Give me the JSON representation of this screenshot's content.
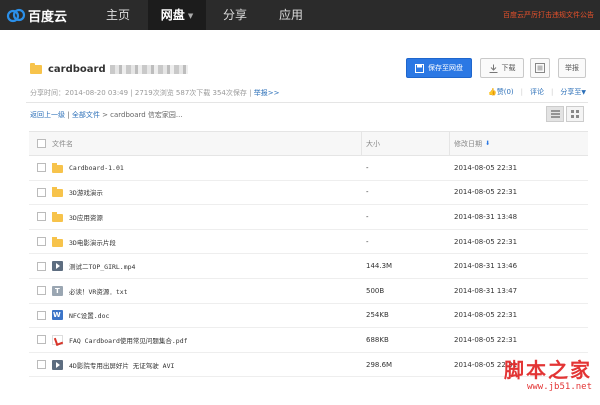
{
  "header": {
    "logo_text": "百度云",
    "nav": [
      {
        "label": "主页"
      },
      {
        "label": "网盘",
        "active": true
      },
      {
        "label": "分享"
      },
      {
        "label": "应用"
      }
    ],
    "notice": "百度云严厉打击违规文件公告"
  },
  "share": {
    "title": "cardboard",
    "buttons": {
      "save": "保存至网盘",
      "download": "下载",
      "report": "举报"
    },
    "meta": "分享时间：2014-08-20 03:49 | 2719次浏览 587次下载 354次保存 |",
    "report_link": "举报>>",
    "actions": {
      "like": "赞(0)",
      "comment": "评论",
      "share_to": "分享至"
    }
  },
  "breadcrumb": {
    "back": "返回上一级",
    "all": "全部文件",
    "path": "> cardboard 信宏家园..."
  },
  "table": {
    "headers": {
      "name": "文件名",
      "size": "大小",
      "date": "修改日期"
    },
    "rows": [
      {
        "icon": "folder",
        "name": "Cardboard-1.01",
        "size": "-",
        "date": "2014-08-05 22:31"
      },
      {
        "icon": "folder",
        "name": "3D游戏演示",
        "size": "-",
        "date": "2014-08-05 22:31"
      },
      {
        "icon": "folder",
        "name": "3D应用资源",
        "size": "-",
        "date": "2014-08-31 13:48"
      },
      {
        "icon": "folder",
        "name": "3D电影演示片段",
        "size": "-",
        "date": "2014-08-05 22:31"
      },
      {
        "icon": "video",
        "name": "测试二TOP_GIRL.mp4",
        "size": "144.3M",
        "date": "2014-08-31 13:46"
      },
      {
        "icon": "txt",
        "name": "必读！VR资源．txt",
        "size": "500B",
        "date": "2014-08-31 13:47"
      },
      {
        "icon": "doc",
        "name": "NFC设置.doc",
        "size": "254KB",
        "date": "2014-08-05 22:31"
      },
      {
        "icon": "pdf",
        "name": "FAQ Cardboard使用常见问题集合.pdf",
        "size": "688KB",
        "date": "2014-08-05 22:31"
      },
      {
        "icon": "video",
        "name": "4D影院专用出屏好片 无证驾驶 AVI",
        "size": "298.6M",
        "date": "2014-08-05 22:31"
      }
    ]
  },
  "watermark": {
    "main": "脚本之家",
    "sub": "www.jb51.net"
  },
  "colors": {
    "topbar": "#2b2b2b",
    "primary": "#2b78e4",
    "link": "#2b6fb8",
    "notice": "#e8512b",
    "folder": "#f7c34b"
  }
}
